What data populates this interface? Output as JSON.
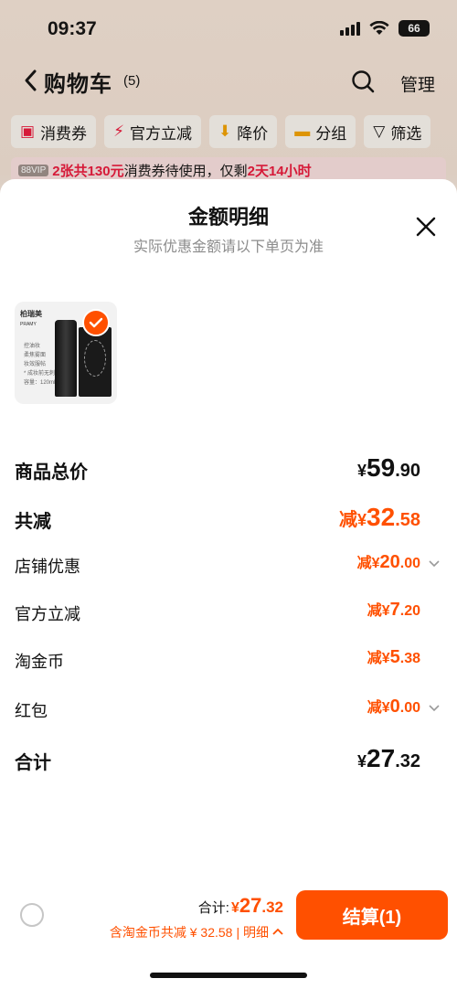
{
  "status": {
    "time": "09:37",
    "battery": "66"
  },
  "nav": {
    "title": "购物车",
    "count": "(5)",
    "manage": "管理"
  },
  "chips": [
    {
      "label": "消费券",
      "icon": "coupon-icon"
    },
    {
      "label": "官方立减",
      "icon": "lightning-icon"
    },
    {
      "label": "降价",
      "icon": "down-arrow-icon"
    },
    {
      "label": "分组",
      "icon": "folder-icon"
    },
    {
      "label": "筛选",
      "icon": "filter-icon"
    }
  ],
  "promo": {
    "badge": "88VIP",
    "part1": "2张共130元",
    "part2": "消费券待使用，仅剩",
    "part3": "2天14小时"
  },
  "sheet": {
    "title": "金额明细",
    "subtitle": "实际优惠金额请以下单页为准",
    "product": {
      "brand": "柏瑞美",
      "brand_sub": "PRAMY",
      "text1": "控油妆",
      "text2": "柔焦雾面",
      "text3": "妆效服帖",
      "text4": "* 成妆前无刺激",
      "text5": "容量：120ml"
    },
    "rows": [
      {
        "label": "商品总价",
        "prefix": "",
        "yen": "¥",
        "int": "59",
        "dec": ".90",
        "style": "total"
      },
      {
        "label": "共减",
        "prefix": "减",
        "yen": "¥",
        "int": "32",
        "dec": ".58",
        "style": "reduce-total"
      },
      {
        "label": "店铺优惠",
        "prefix": "减",
        "yen": "¥",
        "int": "20",
        "dec": ".00",
        "style": "item",
        "arrow": true
      },
      {
        "label": "官方立减",
        "prefix": "减",
        "yen": "¥",
        "int": "7",
        "dec": ".20",
        "style": "item"
      },
      {
        "label": "淘金币",
        "prefix": "减",
        "yen": "¥",
        "int": "5",
        "dec": ".38",
        "style": "item"
      },
      {
        "label": "红包",
        "prefix": "减",
        "yen": "¥",
        "int": "0",
        "dec": ".00",
        "style": "item",
        "arrow": true
      },
      {
        "label": "合计",
        "prefix": "",
        "yen": "¥",
        "int": "27",
        "dec": ".32",
        "style": "sum"
      }
    ]
  },
  "bottom": {
    "total_label": "合计:",
    "total_yen": "¥",
    "total_int": "27",
    "total_dec": ".32",
    "discount_text": "含淘金币共减 ¥ 32.58",
    "detail_label": "| 明细",
    "checkout_label": "结算(1)"
  },
  "colors": {
    "accent": "#ff5000",
    "promo_red": "#e8173a"
  }
}
